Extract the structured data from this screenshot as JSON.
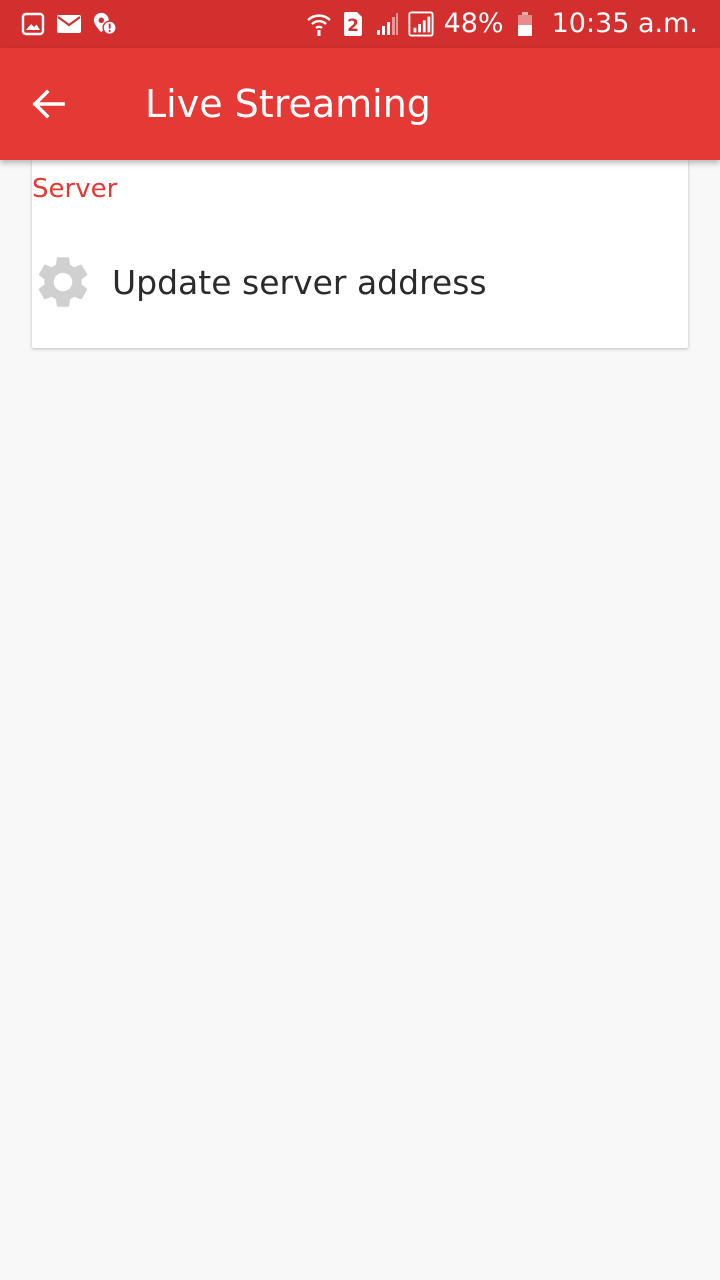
{
  "status_bar": {
    "battery": "48%",
    "time": "10:35 a.m.",
    "sim_slot": "2",
    "icons": [
      "gallery-icon",
      "mail-icon",
      "location-alert-icon",
      "wifi-icon",
      "sim-2-icon",
      "signal-icon",
      "signal-icon",
      "battery-icon"
    ]
  },
  "app_bar": {
    "title": "Live Streaming"
  },
  "settings": {
    "category": "Server",
    "items": [
      {
        "label": "Update server address",
        "icon": "gear-icon"
      }
    ]
  },
  "colors": {
    "status_bar": "#d32f2f",
    "app_bar": "#e53935",
    "accent": "#e53935",
    "background": "#f8f8f8",
    "gear_icon": "#d0d0d0"
  }
}
